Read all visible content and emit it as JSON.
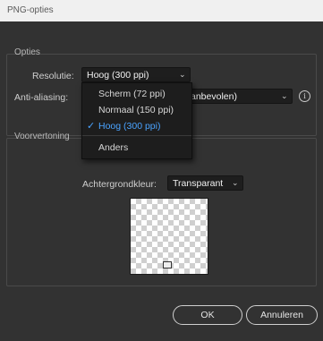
{
  "window": {
    "title": "PNG-opties"
  },
  "options": {
    "legend": "Opties",
    "resolution_label": "Resolutie:",
    "resolution_value": "Hoog (300 ppi)",
    "antialias_label": "Anti-aliasing:",
    "antialias_value_partial": "anbevolen)"
  },
  "resolution_menu": {
    "items": [
      {
        "label": "Scherm (72 ppi)",
        "selected": false
      },
      {
        "label": "Normaal (150 ppi)",
        "selected": false
      },
      {
        "label": "Hoog (300 ppi)",
        "selected": true
      },
      {
        "label": "Anders",
        "selected": false
      }
    ]
  },
  "preview": {
    "legend": "Voorvertoning",
    "bg_label": "Achtergrondkleur:",
    "bg_value": "Transparant"
  },
  "buttons": {
    "ok": "OK",
    "cancel": "Annuleren"
  },
  "colors": {
    "background": "#323232",
    "accent": "#4aa3ff",
    "field": "#1e1e1e"
  },
  "icons": {
    "chevron": "chevron-down-icon",
    "info": "info-icon",
    "check": "checkmark-icon"
  }
}
